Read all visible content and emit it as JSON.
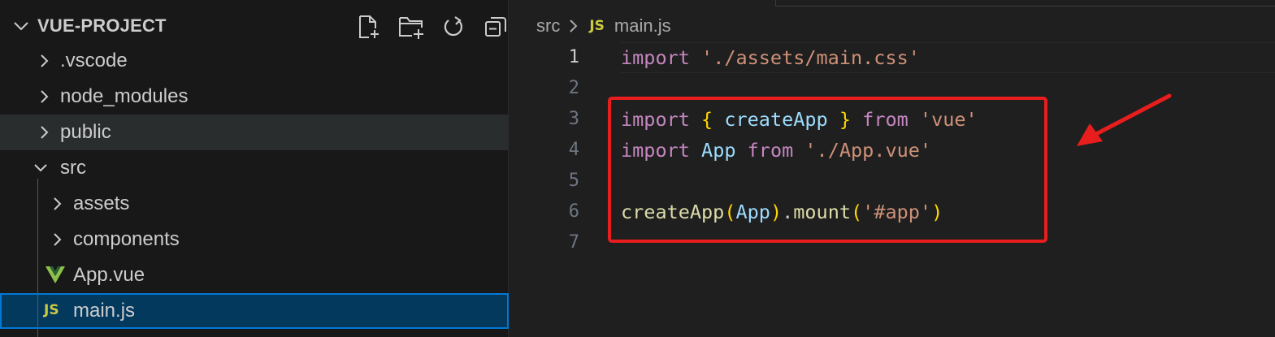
{
  "explorer": {
    "title": "VUE-PROJECT",
    "actions": [
      {
        "name": "new-file-icon"
      },
      {
        "name": "new-folder-icon"
      },
      {
        "name": "refresh-icon"
      },
      {
        "name": "collapse-all-icon"
      }
    ],
    "items": [
      {
        "label": ".vscode",
        "type": "folder",
        "expanded": false,
        "depth": 0
      },
      {
        "label": "node_modules",
        "type": "folder",
        "expanded": false,
        "depth": 0
      },
      {
        "label": "public",
        "type": "folder",
        "expanded": false,
        "depth": 0,
        "hover": true
      },
      {
        "label": "src",
        "type": "folder",
        "expanded": true,
        "depth": 0
      },
      {
        "label": "assets",
        "type": "folder",
        "expanded": false,
        "depth": 1
      },
      {
        "label": "components",
        "type": "folder",
        "expanded": false,
        "depth": 1
      },
      {
        "label": "App.vue",
        "type": "vue-file",
        "depth": 1
      },
      {
        "label": "main.js",
        "type": "js-file",
        "depth": 1,
        "selected": true
      }
    ]
  },
  "editor": {
    "breadcrumb": {
      "folder": "src",
      "file_badge": "JS",
      "file": "main.js"
    },
    "active_line": 1,
    "lines": [
      {
        "number": "1",
        "tokens": [
          {
            "t": "import",
            "c": "kw"
          },
          {
            "t": " ",
            "c": ""
          },
          {
            "t": "'./assets/main.css'",
            "c": "str"
          }
        ]
      },
      {
        "number": "2",
        "tokens": []
      },
      {
        "number": "3",
        "tokens": [
          {
            "t": "import",
            "c": "kw"
          },
          {
            "t": " ",
            "c": ""
          },
          {
            "t": "{",
            "c": "br1"
          },
          {
            "t": " ",
            "c": ""
          },
          {
            "t": "createApp",
            "c": "var"
          },
          {
            "t": " ",
            "c": ""
          },
          {
            "t": "}",
            "c": "br1"
          },
          {
            "t": " ",
            "c": ""
          },
          {
            "t": "from",
            "c": "kw"
          },
          {
            "t": " ",
            "c": ""
          },
          {
            "t": "'vue'",
            "c": "str"
          }
        ]
      },
      {
        "number": "4",
        "tokens": [
          {
            "t": "import",
            "c": "kw"
          },
          {
            "t": " ",
            "c": ""
          },
          {
            "t": "App",
            "c": "var"
          },
          {
            "t": " ",
            "c": ""
          },
          {
            "t": "from",
            "c": "kw"
          },
          {
            "t": " ",
            "c": ""
          },
          {
            "t": "'./App.vue'",
            "c": "str"
          }
        ]
      },
      {
        "number": "5",
        "tokens": []
      },
      {
        "number": "6",
        "tokens": [
          {
            "t": "createApp",
            "c": "fn"
          },
          {
            "t": "(",
            "c": "br1"
          },
          {
            "t": "App",
            "c": "var"
          },
          {
            "t": ")",
            "c": "br1"
          },
          {
            "t": ".",
            "c": ""
          },
          {
            "t": "mount",
            "c": "fn"
          },
          {
            "t": "(",
            "c": "br1"
          },
          {
            "t": "'#app'",
            "c": "str"
          },
          {
            "t": ")",
            "c": "br1"
          }
        ]
      },
      {
        "number": "7",
        "tokens": []
      }
    ]
  },
  "annotation": {
    "box_color": "#e81d1d",
    "arrow_color": "#e81d1d"
  },
  "colors": {
    "sidebar_bg": "#181818",
    "editor_bg": "#1f1f1f",
    "selection_bg": "#04395e",
    "selection_border": "#0078d4",
    "js_badge": "#cbcb41",
    "vue_green": "#8dc149"
  }
}
